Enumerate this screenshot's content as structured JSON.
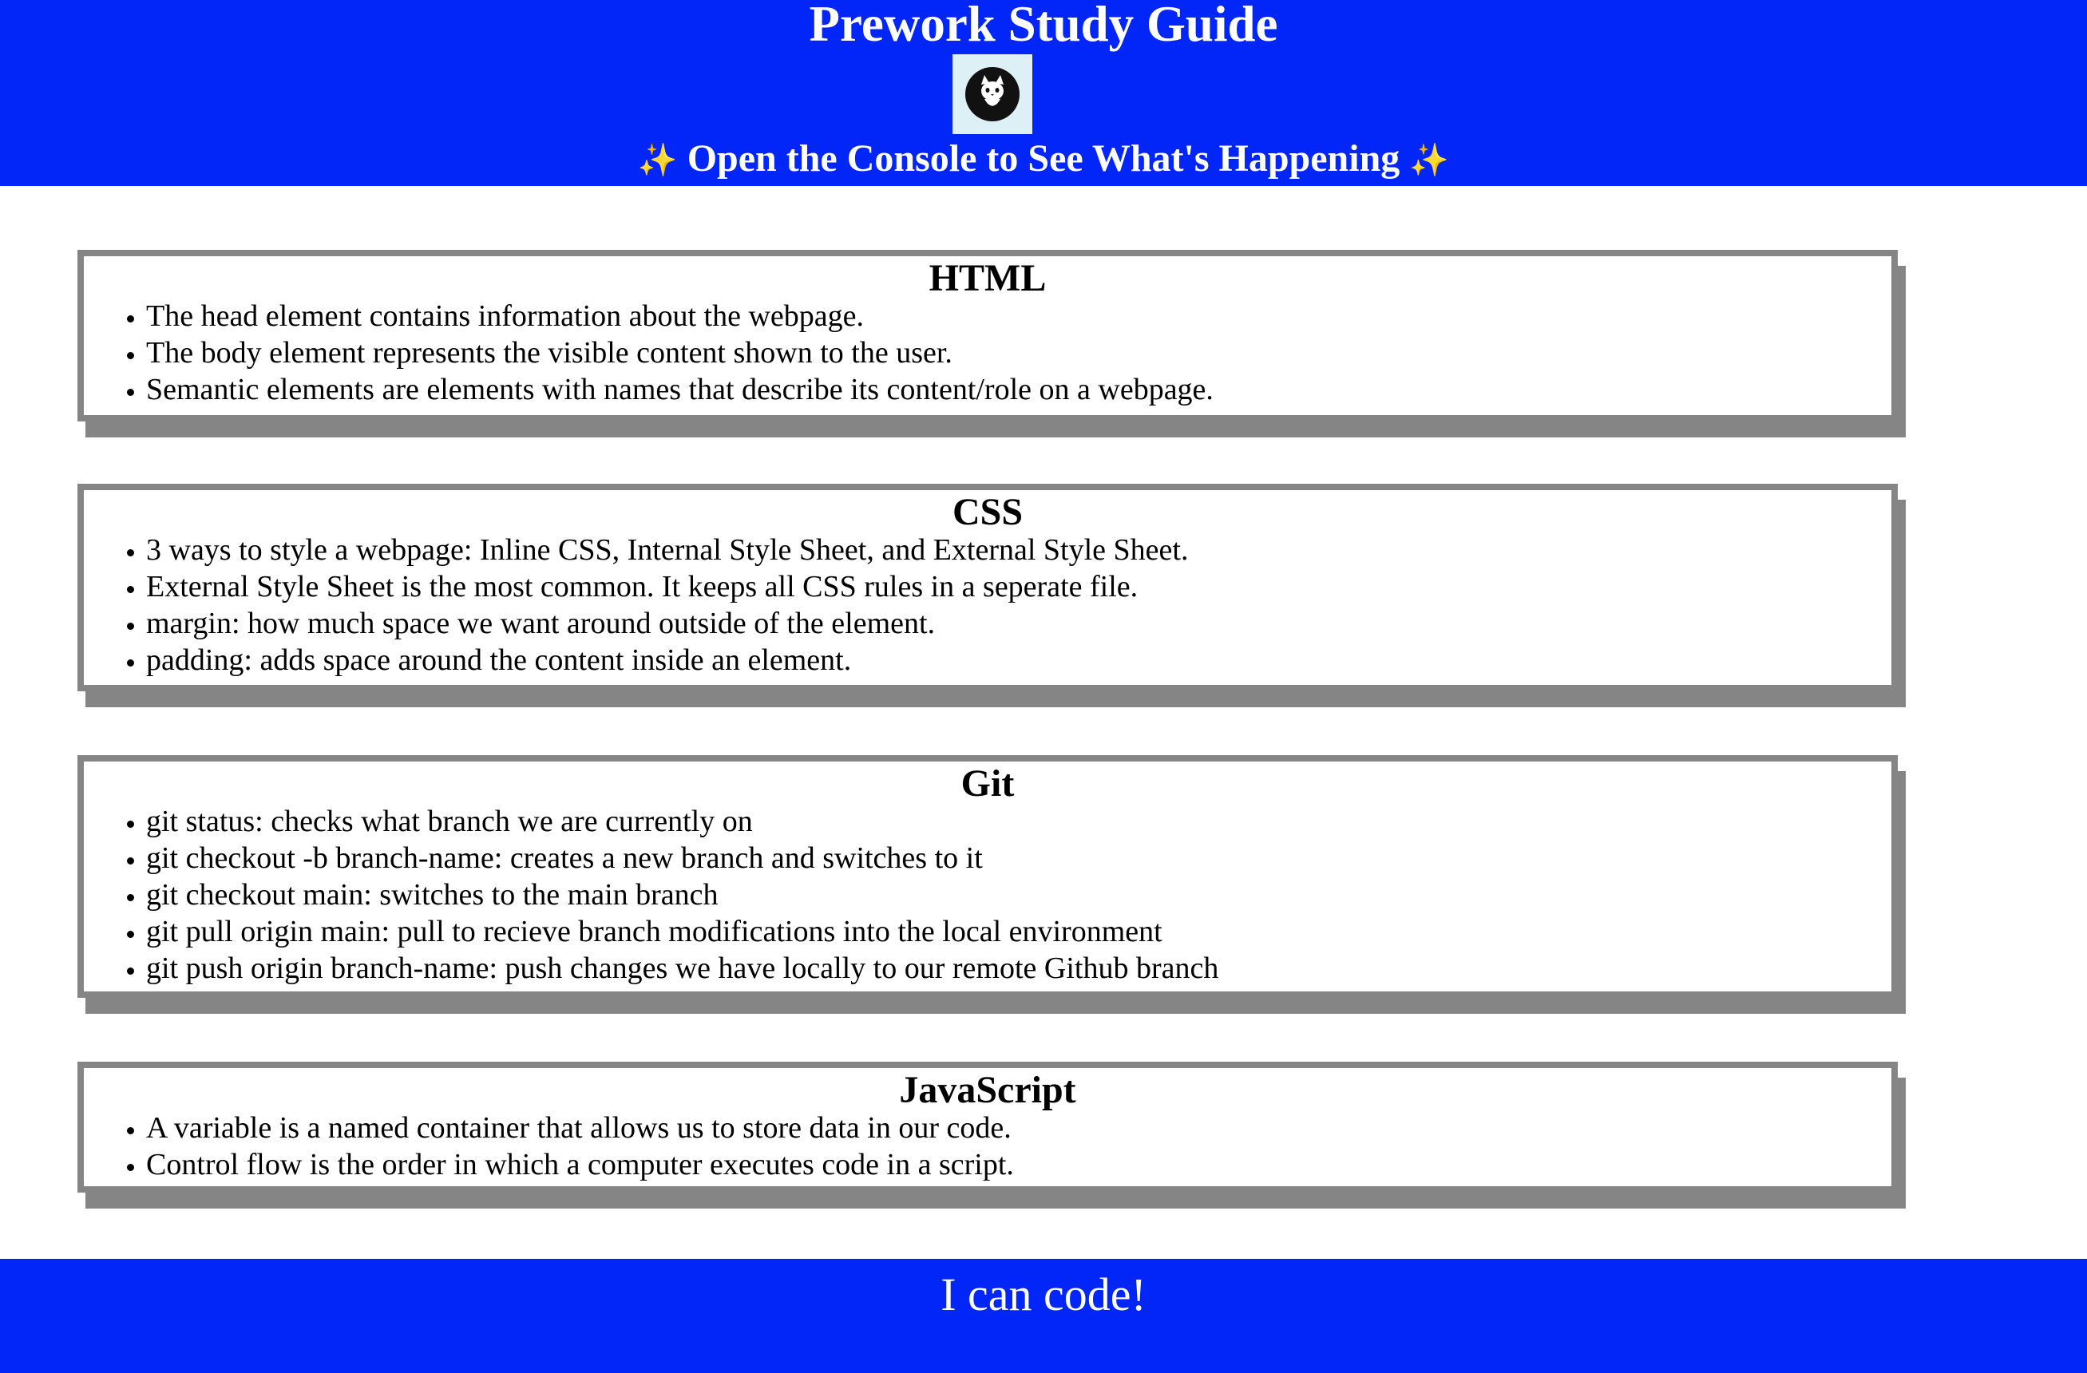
{
  "header": {
    "title": "Prework Study Guide",
    "subtitle": "Open the Console to See What's Happening",
    "sparkle": "✨",
    "logo_icon": "cat-icon",
    "background_color": "#0126f7"
  },
  "sections": [
    {
      "title": "HTML",
      "items": [
        "The head element contains information about the webpage.",
        "The body element represents the visible content shown to the user.",
        "Semantic elements are elements with names that describe its content/role on a webpage."
      ]
    },
    {
      "title": "CSS",
      "items": [
        "3 ways to style a webpage: Inline CSS, Internal Style Sheet, and External Style Sheet.",
        "External Style Sheet is the most common. It keeps all CSS rules in a seperate file.",
        "margin: how much space we want around outside of the element.",
        "padding: adds space around the content inside an element."
      ]
    },
    {
      "title": "Git",
      "items": [
        "git status: checks what branch we are currently on",
        "git checkout -b branch-name: creates a new branch and switches to it",
        "git checkout main: switches to the main branch",
        "git pull origin main: pull to recieve branch modifications into the local environment",
        "git push origin branch-name: push changes we have locally to our remote Github branch"
      ]
    },
    {
      "title": "JavaScript",
      "items": [
        "A variable is a named container that allows us to store data in our code.",
        "Control flow is the order in which a computer executes code in a script."
      ]
    }
  ],
  "footer": {
    "text": "I can code!"
  }
}
